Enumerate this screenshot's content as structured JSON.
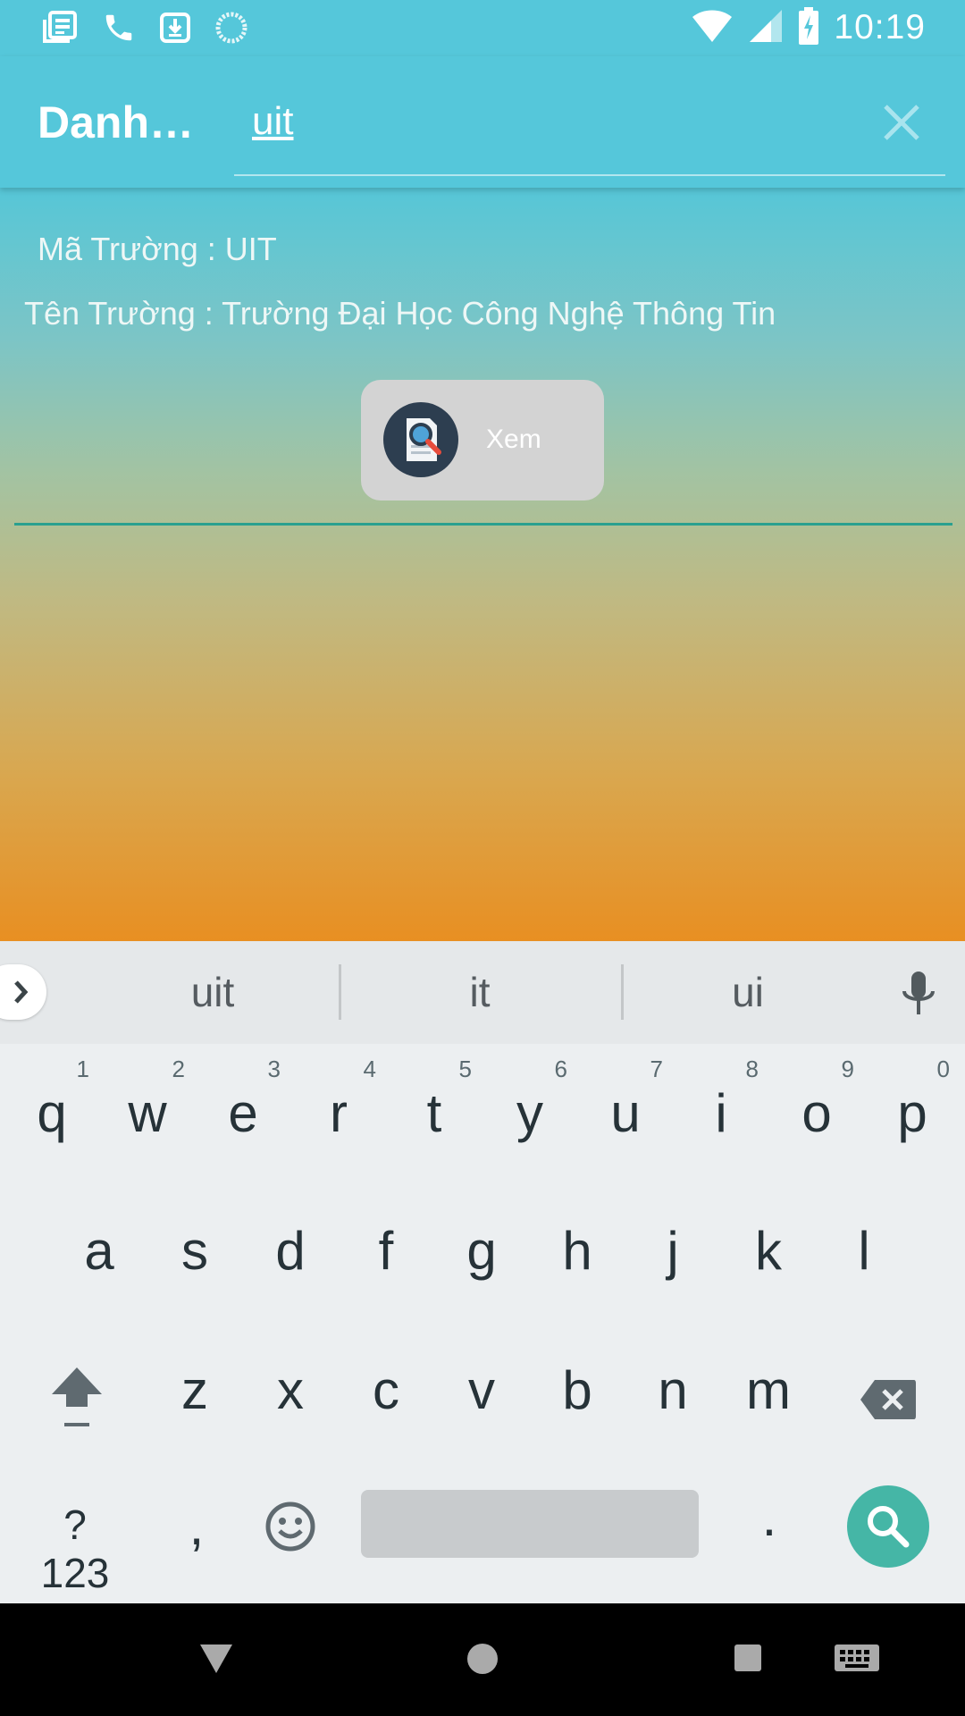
{
  "status_bar": {
    "time": "10:19",
    "left_icons": [
      "news-icon",
      "phone-icon",
      "download-icon",
      "loading-icon"
    ],
    "right_icons": [
      "wifi-icon",
      "signal-icon",
      "battery-charging-icon"
    ]
  },
  "toolbar": {
    "title": "Danh…",
    "search_value": "uit"
  },
  "result": {
    "code_line": "Mã Trường : UIT",
    "name_line": "Tên Trường : Trường Đại Học Công Nghệ Thông Tin",
    "view_button_label": "Xem"
  },
  "keyboard": {
    "suggestions": [
      "uit",
      "it",
      "ui"
    ],
    "row1": [
      {
        "key": "q",
        "num": "1"
      },
      {
        "key": "w",
        "num": "2"
      },
      {
        "key": "e",
        "num": "3"
      },
      {
        "key": "r",
        "num": "4"
      },
      {
        "key": "t",
        "num": "5"
      },
      {
        "key": "y",
        "num": "6"
      },
      {
        "key": "u",
        "num": "7"
      },
      {
        "key": "i",
        "num": "8"
      },
      {
        "key": "o",
        "num": "9"
      },
      {
        "key": "p",
        "num": "0"
      }
    ],
    "row2": [
      "a",
      "s",
      "d",
      "f",
      "g",
      "h",
      "j",
      "k",
      "l"
    ],
    "row3": [
      "z",
      "x",
      "c",
      "v",
      "b",
      "n",
      "m"
    ],
    "symbols_label": "?123",
    "comma": ",",
    "period": "."
  },
  "colors": {
    "accent": "#55c7da",
    "divider": "#2aa08f",
    "search_key": "#45b6a6"
  }
}
